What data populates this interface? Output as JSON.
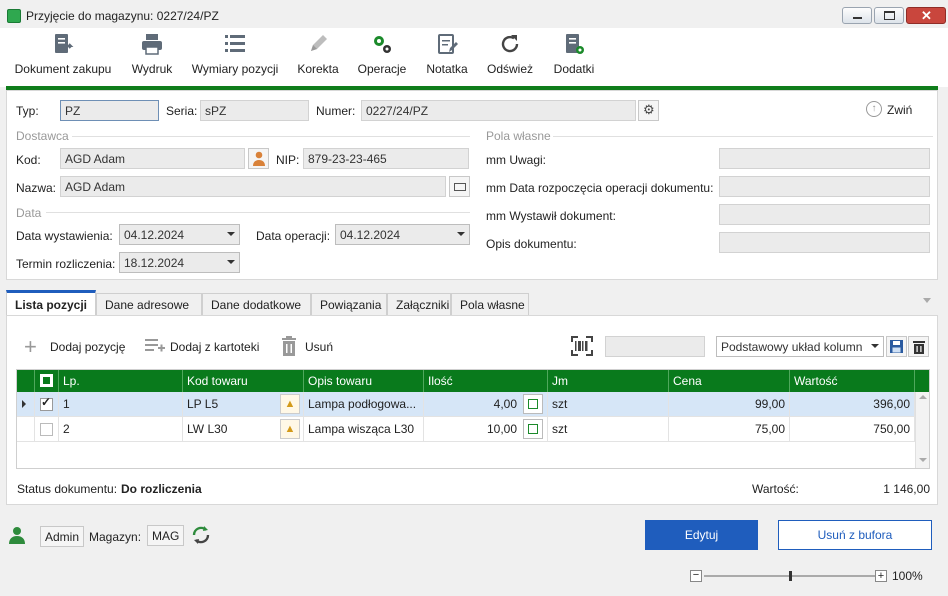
{
  "window": {
    "title": "Przyjęcie do magazynu: 0227/24/PZ"
  },
  "toolbar": [
    {
      "label": "Dokument zakupu",
      "icon": "purchase-document-icon"
    },
    {
      "label": "Wydruk",
      "icon": "printer-icon"
    },
    {
      "label": "Wymiary pozycji",
      "icon": "list-icon"
    },
    {
      "label": "Korekta",
      "icon": "pencil-icon"
    },
    {
      "label": "Operacje",
      "icon": "gears-icon"
    },
    {
      "label": "Notatka",
      "icon": "note-icon"
    },
    {
      "label": "Odśwież",
      "icon": "refresh-icon"
    },
    {
      "label": "Dodatki",
      "icon": "addons-icon"
    }
  ],
  "header": {
    "typ_label": "Typ:",
    "typ_value": "PZ",
    "seria_label": "Seria:",
    "seria_value": "sPZ",
    "numer_label": "Numer:",
    "numer_value": "0227/24/PZ",
    "collapse_label": "Zwiń"
  },
  "supplier": {
    "section": "Dostawca",
    "kod_label": "Kod:",
    "kod_value": "AGD Adam",
    "nip_label": "NIP:",
    "nip_value": "879-23-23-465",
    "nazwa_label": "Nazwa:",
    "nazwa_value": "AGD Adam"
  },
  "dates": {
    "section": "Data",
    "wyst_label": "Data wystawienia:",
    "wyst_value": "04.12.2024",
    "oper_label": "Data operacji:",
    "oper_value": "04.12.2024",
    "termin_label": "Termin rozliczenia:",
    "termin_value": "18.12.2024"
  },
  "custom": {
    "section": "Pola własne",
    "fields": [
      {
        "label": "mm Uwagi:",
        "value": ""
      },
      {
        "label": "mm Data rozpoczęcia operacji dokumentu:",
        "value": ""
      },
      {
        "label": "mm Wystawił dokument:",
        "value": ""
      },
      {
        "label": "Opis dokumentu:",
        "value": ""
      }
    ]
  },
  "tabs": [
    "Lista pozycji",
    "Dane adresowe",
    "Dane dodatkowe",
    "Powiązania",
    "Załączniki",
    "Pola własne"
  ],
  "actions": {
    "add": "Dodaj pozycję",
    "add_from": "Dodaj z kartoteki",
    "delete": "Usuń",
    "search_value": "",
    "layout": "Podstawowy układ kolumn"
  },
  "grid": {
    "columns": [
      "Lp.",
      "Kod towaru",
      "Opis towaru",
      "Ilość",
      "Jm",
      "Cena",
      "Wartość"
    ],
    "rows": [
      {
        "lp": "1",
        "kod": "LP L5",
        "opis": "Lampa  podłogowa...",
        "ilosc": "4,00",
        "jm": "szt",
        "cena": "99,00",
        "wartosc": "396,00",
        "checked": true
      },
      {
        "lp": "2",
        "kod": "LW L30",
        "opis": "Lampa wisząca L30",
        "ilosc": "10,00",
        "jm": "szt",
        "cena": "75,00",
        "wartosc": "750,00",
        "checked": false
      }
    ]
  },
  "footer": {
    "status_label": "Status dokumentu:",
    "status_value": "Do rozliczenia",
    "total_label": "Wartość:",
    "total_value": "1 146,00"
  },
  "bottom": {
    "user": "Admin",
    "magazyn_label": "Magazyn:",
    "magazyn_value": "MAG",
    "edit": "Edytuj",
    "remove": "Usuń z bufora",
    "zoom": "100%",
    "zoom_level": 0.5
  },
  "colors": {
    "accent_green": "#097a1c",
    "primary_blue": "#1f5dbd"
  }
}
